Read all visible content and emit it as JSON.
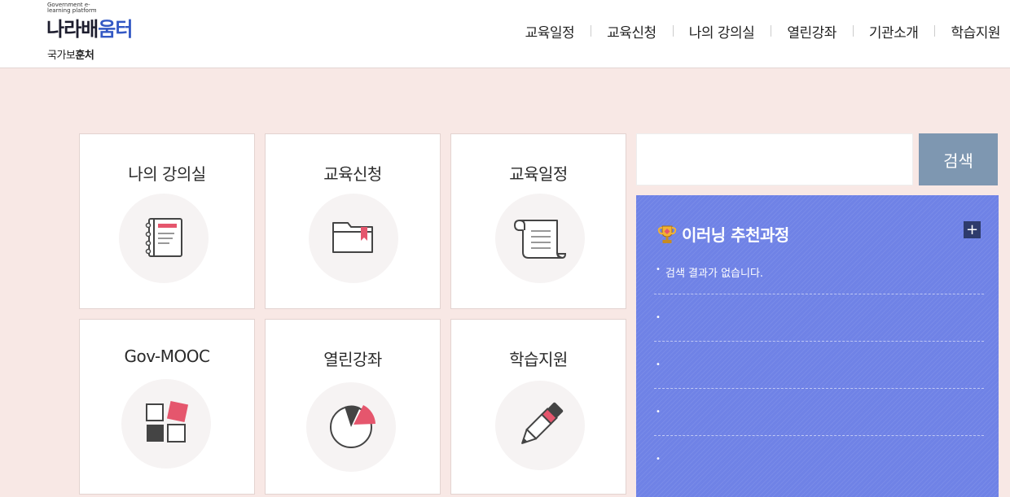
{
  "header": {
    "logo_small": "Government e-learning platform",
    "logo_text_1": "나라배",
    "logo_text_2": "움터",
    "ministry_1": "국가보",
    "ministry_2": "훈처"
  },
  "gnb": [
    "교육일정",
    "교육신청",
    "나의 강의실",
    "열린강좌",
    "기관소개",
    "학습지원"
  ],
  "cards": [
    {
      "title": "나의 강의실",
      "icon": "notebook-icon"
    },
    {
      "title": "교육신청",
      "icon": "folder-icon"
    },
    {
      "title": "교육일정",
      "icon": "scroll-icon"
    },
    {
      "title": "Gov-MOOC",
      "icon": "blocks-icon"
    },
    {
      "title": "열린강좌",
      "icon": "pie-chart-icon"
    },
    {
      "title": "학습지원",
      "icon": "pencil-icon"
    }
  ],
  "search": {
    "value": "",
    "button_label": "검색"
  },
  "panel": {
    "title": "이러닝 추천과정",
    "plus_label": "+",
    "items": [
      "검색 결과가 없습니다.",
      "",
      "",
      "",
      ""
    ]
  },
  "colors": {
    "background": "#f8e8e5",
    "panel": "#6f82e6",
    "search_button": "#7e97b1",
    "accent": "#e5425b"
  }
}
